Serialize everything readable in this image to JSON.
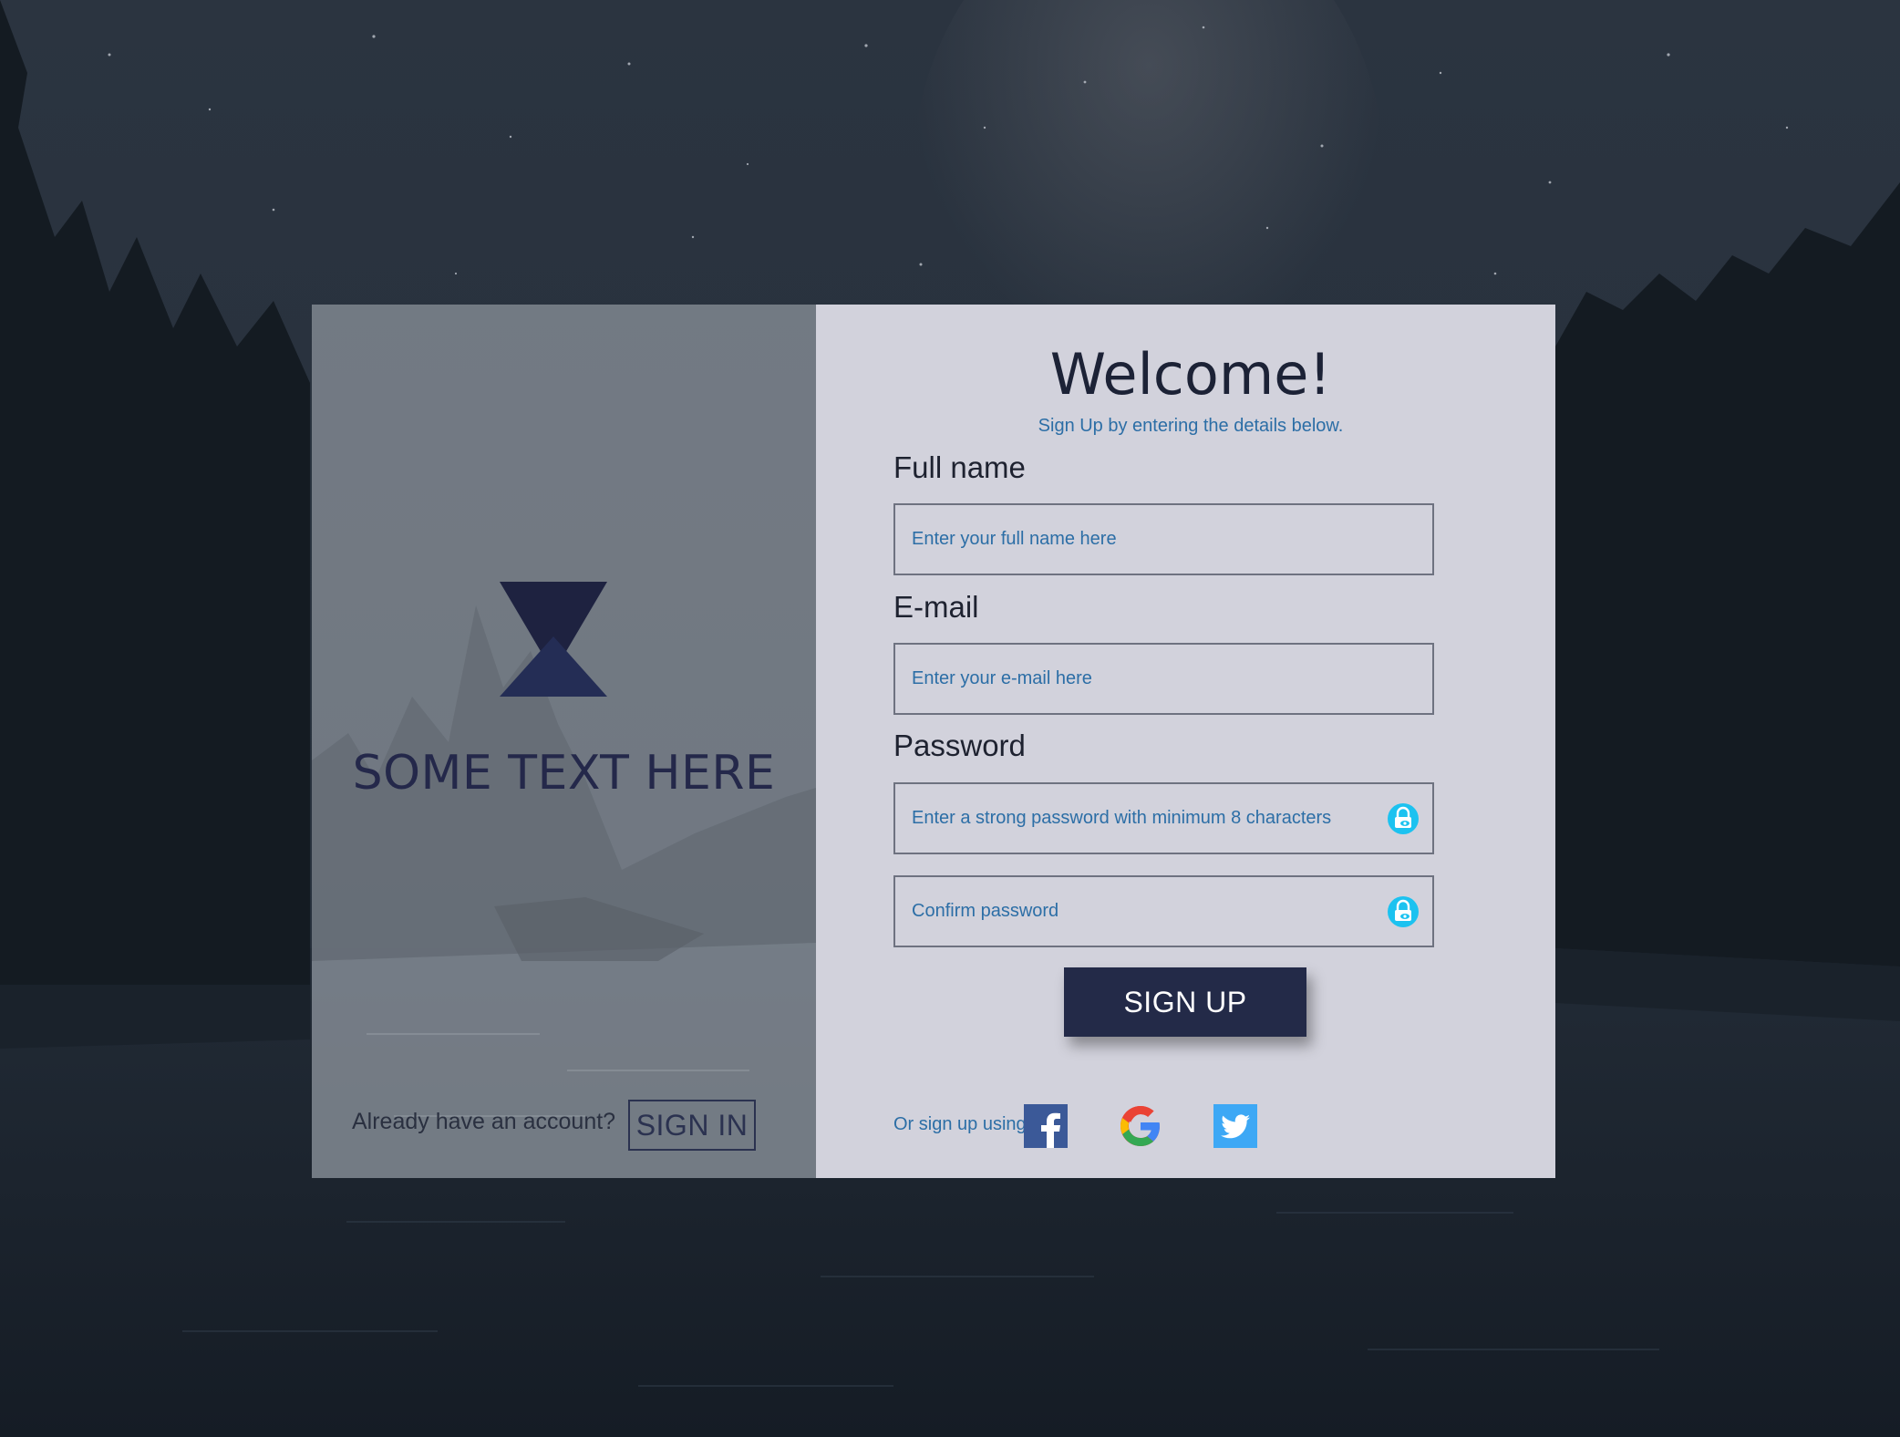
{
  "colors": {
    "accent": "#2c6ea6",
    "dark_navy": "#232a48",
    "lock_icon": "#1cc2f0",
    "card_right_bg": "#d2d2dc"
  },
  "left_panel": {
    "brand_text": "SOME TEXT HERE",
    "already_text": "Already have an account?",
    "signin_label": "SIGN IN"
  },
  "form": {
    "title": "Welcome!",
    "subtitle": "Sign Up by entering the details below.",
    "full_name": {
      "label": "Full name",
      "placeholder": "Enter your full name here",
      "value": ""
    },
    "email": {
      "label": "E-mail",
      "placeholder": "Enter your e-mail here",
      "value": ""
    },
    "password": {
      "label": "Password",
      "placeholder": "Enter a strong password with minimum 8 characters",
      "value": "",
      "icon": "lock-eye-icon"
    },
    "confirm_password": {
      "placeholder": "Confirm password",
      "value": "",
      "icon": "lock-eye-icon"
    },
    "signup_label": "SIGN UP",
    "social_label": "Or sign up using",
    "social": [
      {
        "name": "facebook",
        "icon": "facebook-icon"
      },
      {
        "name": "google",
        "icon": "google-icon"
      },
      {
        "name": "twitter",
        "icon": "twitter-icon"
      }
    ]
  }
}
